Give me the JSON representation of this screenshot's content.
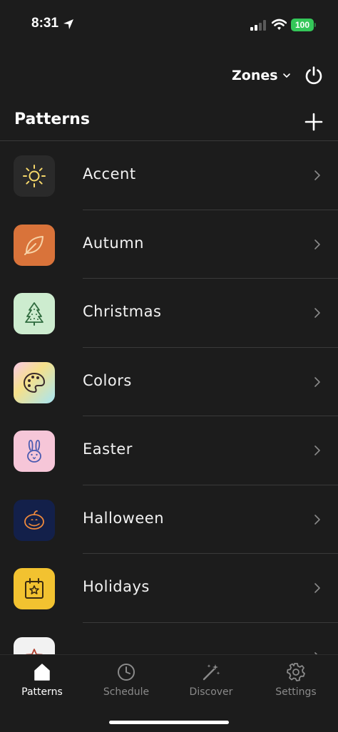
{
  "status_bar": {
    "time": "8:31",
    "battery": "100",
    "icons": [
      "location-icon",
      "signal-icon",
      "wifi-icon",
      "battery-icon"
    ]
  },
  "header": {
    "zones_label": "Zones",
    "title": "Patterns"
  },
  "patterns": [
    {
      "label": "Accent",
      "icon": "sun-icon",
      "color": "#2a2a2a"
    },
    {
      "label": "Autumn",
      "icon": "leaf-icon",
      "color": "#d9733a"
    },
    {
      "label": "Christmas",
      "icon": "tree-icon",
      "color": "#cdeccf"
    },
    {
      "label": "Colors",
      "icon": "palette-icon",
      "color": "gradient"
    },
    {
      "label": "Easter",
      "icon": "bunny-icon",
      "color": "#f6c6d8"
    },
    {
      "label": "Halloween",
      "icon": "pumpkin-icon",
      "color": "#13204a"
    },
    {
      "label": "Holidays",
      "icon": "calendar-star-icon",
      "color": "#f2c230"
    },
    {
      "label": "",
      "icon": "star-icon",
      "color": "#f2f2f2"
    }
  ],
  "tabs": [
    {
      "label": "Patterns",
      "icon": "home-icon",
      "active": true
    },
    {
      "label": "Schedule",
      "icon": "clock-icon",
      "active": false
    },
    {
      "label": "Discover",
      "icon": "magic-wand-icon",
      "active": false
    },
    {
      "label": "Settings",
      "icon": "gear-icon",
      "active": false
    }
  ]
}
